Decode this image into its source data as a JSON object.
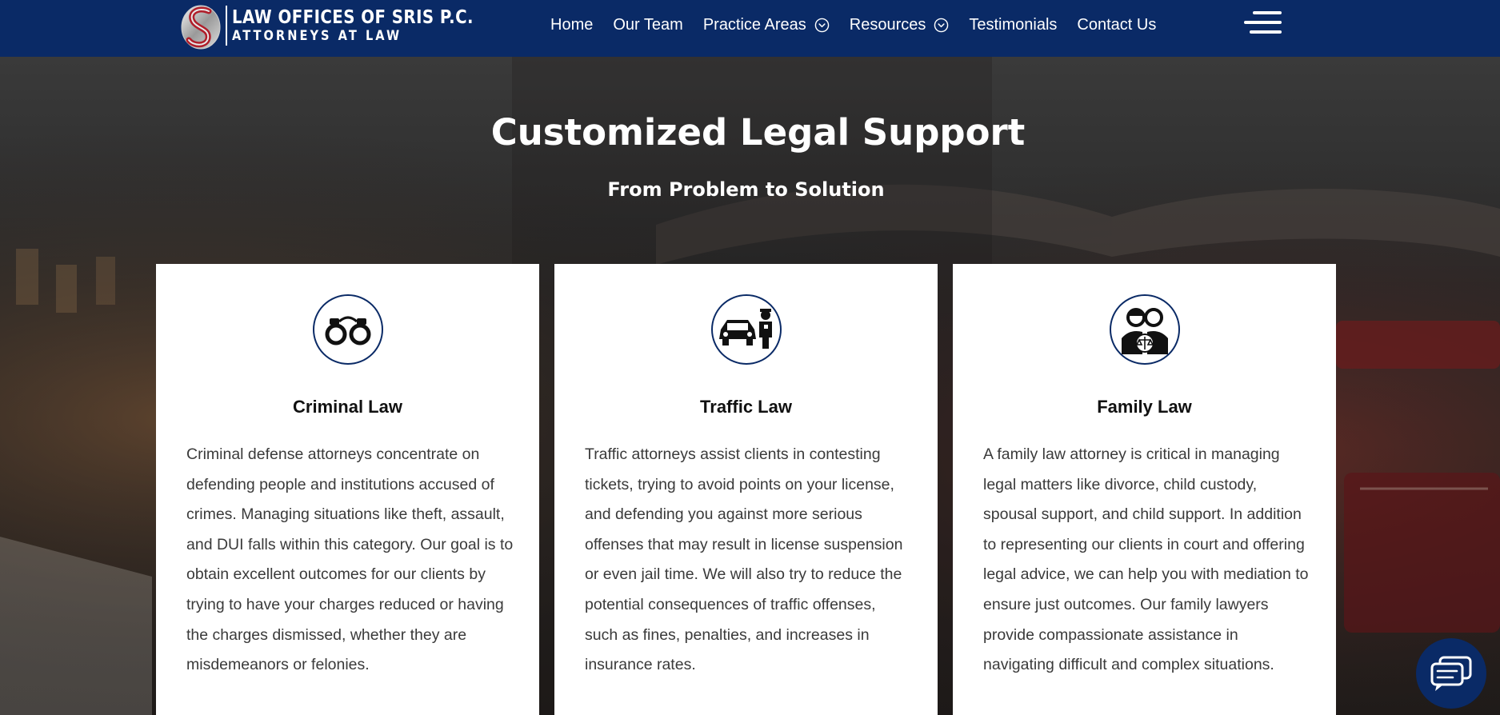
{
  "header": {
    "logo": {
      "line1": "LAW OFFICES OF SRIS P.C.",
      "line2": "ATTORNEYS AT LAW"
    },
    "nav": [
      {
        "label": "Home",
        "has_dropdown": false
      },
      {
        "label": "Our Team",
        "has_dropdown": false
      },
      {
        "label": "Practice Areas",
        "has_dropdown": true
      },
      {
        "label": "Resources",
        "has_dropdown": true
      },
      {
        "label": "Testimonials",
        "has_dropdown": false
      },
      {
        "label": "Contact Us",
        "has_dropdown": false
      }
    ],
    "menu_icon": "hamburger-menu-icon"
  },
  "hero": {
    "title": "Customized Legal Support",
    "subtitle": "From Problem to Solution"
  },
  "cards": [
    {
      "icon": "handcuffs-icon",
      "title": "Criminal Law",
      "body": "Criminal defense attorneys concentrate on defending people and institutions accused of crimes. Managing situations like theft, assault, and DUI falls within this category. Our goal is to obtain excellent outcomes for our clients by trying to have your charges reduced or having the charges dismissed, whether they are misdemeanors or felonies."
    },
    {
      "icon": "car-police-icon",
      "title": "Traffic Law",
      "body": "Traffic attorneys assist clients in contesting tickets, trying to avoid points on your license, and defending you against more serious offenses that may result in license suspension or even jail time. We will also try to reduce the potential consequences of traffic offenses, such as fines, penalties, and increases in insurance rates."
    },
    {
      "icon": "family-scales-icon",
      "title": "Family Law",
      "body": "A family law attorney is critical in managing legal matters like divorce, child custody, spousal support, and child support. In addition to representing our clients in court and offering legal advice, we can help you with mediation to ensure just outcomes. Our family lawyers provide compassionate assistance in navigating difficult and complex situations."
    }
  ],
  "chat": {
    "icon": "chat-bubble-icon"
  },
  "colors": {
    "brand_navy": "#0a2a66",
    "card_bg": "#ffffff",
    "text_dark": "#3a3a3a"
  }
}
